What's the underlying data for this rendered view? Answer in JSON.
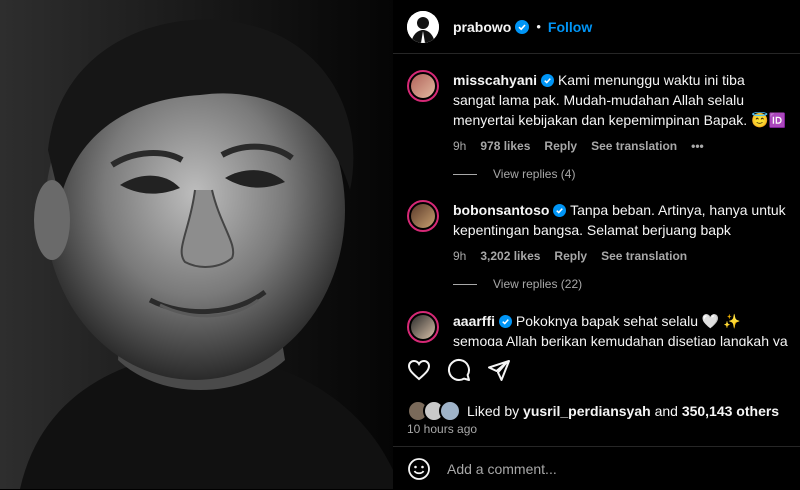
{
  "post": {
    "author": "prabowo",
    "separator": "•",
    "follow_label": "Follow"
  },
  "comments": [
    {
      "username": "misscahyani",
      "text": "Kami menunggu waktu ini tiba sangat lama pak. Mudah-mudahan Allah selalu menyertai kebijakan dan kepemimpinan Bapak. 😇🆔",
      "time": "9h",
      "likes": "978 likes",
      "reply": "Reply",
      "translate": "See translation",
      "more": "•••",
      "replies": "View replies (4)"
    },
    {
      "username": "bobonsantoso",
      "text": "Tanpa beban. Artinya, hanya untuk kepentingan bangsa. Selamat berjuang bapk",
      "time": "9h",
      "likes": "3,202 likes",
      "reply": "Reply",
      "translate": "See translation",
      "replies": "View replies (22)"
    },
    {
      "username": "aaarffi",
      "text": "Pokoknya bapak sehat selalu 🤍 ✨ semoga Allah berikan kemudahan disetiap langkah ya pak 🤲🏻"
    }
  ],
  "likes": {
    "prefix": "Liked by",
    "user": "yusril_perdiansyah",
    "middle": "and",
    "count": "350,143 others"
  },
  "timestamp": "10 hours ago",
  "composer": {
    "placeholder": "Add a comment..."
  },
  "colors": {
    "accent": "#0095f6",
    "verified": "#0095f6",
    "muted": "#a8a8a8"
  }
}
